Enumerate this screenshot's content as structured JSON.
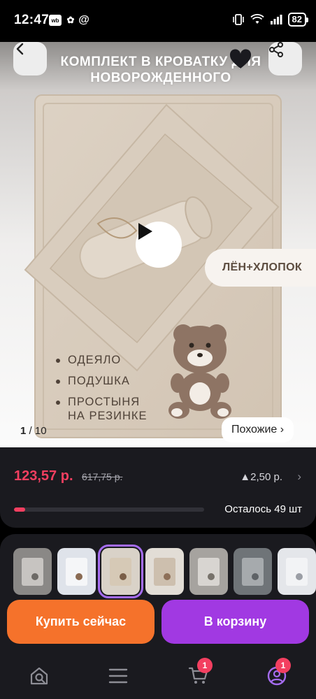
{
  "status_bar": {
    "time": "12:47",
    "apps": [
      "wb",
      "@"
    ],
    "battery": "82"
  },
  "product": {
    "image_title": "КОМПЛЕКТ В КРОВАТКУ ДЛЯ НОВОРОЖДЕННОГО",
    "material_tag": "ЛЁН+ХЛОПОК",
    "bullets": [
      {
        "line1": "ОДЕЯЛО",
        "line2": ""
      },
      {
        "line1": "ПОДУШКА",
        "line2": ""
      },
      {
        "line1": "ПРОСТЫНЯ",
        "line2": "НА РЕЗИНКЕ"
      }
    ],
    "image_index": "1",
    "image_total": "/ 10",
    "similar_label": "Похожие ›"
  },
  "price": {
    "current": "123,57 р.",
    "old": "617,75 р.",
    "bonus": "▲2,50 р.",
    "bonus_chevron": "›",
    "stock_text": "Осталось 49 шт",
    "stock_fraction": 0.06
  },
  "thumbnails": [
    {
      "bg": "#8a8886",
      "blanket": "#c7c4c1",
      "bear": "#6d6a66",
      "active": false
    },
    {
      "bg": "#dfe3ea",
      "blanket": "#f5f6f8",
      "bear": "#8a6b53",
      "active": false
    },
    {
      "bg": "#d9d2c8",
      "blanket": "#d6c9b6",
      "bear": "#7a5e48",
      "active": true
    },
    {
      "bg": "#e2ddd6",
      "blanket": "#cdbfae",
      "bear": "#8d6f58",
      "active": false
    },
    {
      "bg": "#a6a39f",
      "blanket": "#d8d5d1",
      "bear": "#77726b",
      "active": false
    },
    {
      "bg": "#6f7478",
      "blanket": "#a6aaad",
      "bear": "#5e6266",
      "active": false
    },
    {
      "bg": "#e4e6ea",
      "blanket": "#f2f3f5",
      "bear": "#9b9ea5",
      "active": false
    }
  ],
  "actions": {
    "buy_now": "Купить сейчас",
    "add_to_cart": "В корзину"
  },
  "nav": {
    "cart_badge": "1",
    "profile_badge": "1"
  },
  "colors": {
    "accent_red": "#f33f60",
    "buy_orange": "#f5722b",
    "cart_purple": "#a139e2",
    "card_bg": "#1a1a1f"
  }
}
